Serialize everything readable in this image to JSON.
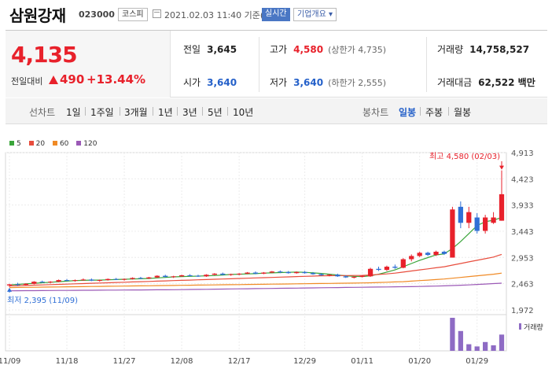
{
  "header": {
    "name": "삼원강재",
    "code": "023000",
    "market": "코스피",
    "timestamp": "2021.02.03 11:40 기준(장중)",
    "realtime_label": "실시간",
    "corp_info_label": "기업개요 ▾"
  },
  "quote": {
    "price": "4,135",
    "change_label": "전일대비",
    "change": "490",
    "change_pct": "+13.44%",
    "prev_close_label": "전일",
    "prev_close": "3,645",
    "high_label": "고가",
    "high": "4,580",
    "upper_limit": "(상한가 4,735)",
    "volume_label": "거래량",
    "volume": "14,758,527",
    "open_label": "시가",
    "open": "3,640",
    "low_label": "저가",
    "low": "3,640",
    "lower_limit": "(하한가 2,555)",
    "value_label": "거래대금",
    "value": "62,522 백만"
  },
  "periods": {
    "label": "선차트",
    "items": [
      "1일",
      "1주일",
      "3개월",
      "1년",
      "3년",
      "5년",
      "10년"
    ],
    "candle_label": "봉차트",
    "candle_items": [
      "일봉",
      "주봉",
      "월봉"
    ],
    "candle_selected": "일봉"
  },
  "legend": [
    {
      "label": "5",
      "color": "#3aa53a"
    },
    {
      "label": "20",
      "color": "#e84d3d"
    },
    {
      "label": "60",
      "color": "#f08a25"
    },
    {
      "label": "120",
      "color": "#9b59b6"
    }
  ],
  "chart_data": {
    "type": "candlestick",
    "y_ticks": [
      "4,913",
      "4,423",
      "3,933",
      "3,443",
      "2,953",
      "2,463",
      "1,972"
    ],
    "y_tick_values": [
      4913,
      4423,
      3933,
      3443,
      2953,
      2463,
      1972
    ],
    "ylim": [
      1972,
      4913
    ],
    "x_tick_labels": [
      "11/09",
      "11/18",
      "11/27",
      "12/08",
      "12/17",
      "12/29",
      "01/11",
      "01/20",
      "01/29"
    ],
    "x_tick_index": [
      0,
      7,
      14,
      21,
      28,
      36,
      43,
      50,
      57
    ],
    "max_annotation": "최고 4,580 (02/03)",
    "min_annotation": "최저 2,395 (11/09)",
    "volume_label": "거래량",
    "candles": [
      [
        2430,
        2460,
        2400,
        2450
      ],
      [
        2450,
        2480,
        2420,
        2440
      ],
      [
        2440,
        2470,
        2430,
        2460
      ],
      [
        2460,
        2510,
        2450,
        2500
      ],
      [
        2500,
        2520,
        2480,
        2490
      ],
      [
        2490,
        2510,
        2470,
        2500
      ],
      [
        2500,
        2540,
        2490,
        2530
      ],
      [
        2530,
        2550,
        2510,
        2520
      ],
      [
        2520,
        2540,
        2500,
        2530
      ],
      [
        2530,
        2560,
        2520,
        2540
      ],
      [
        2540,
        2560,
        2510,
        2520
      ],
      [
        2520,
        2540,
        2500,
        2530
      ],
      [
        2530,
        2560,
        2520,
        2550
      ],
      [
        2550,
        2570,
        2530,
        2540
      ],
      [
        2540,
        2560,
        2520,
        2550
      ],
      [
        2550,
        2580,
        2540,
        2570
      ],
      [
        2570,
        2590,
        2550,
        2560
      ],
      [
        2560,
        2590,
        2550,
        2580
      ],
      [
        2580,
        2620,
        2570,
        2610
      ],
      [
        2610,
        2630,
        2580,
        2590
      ],
      [
        2590,
        2610,
        2570,
        2600
      ],
      [
        2600,
        2630,
        2590,
        2620
      ],
      [
        2620,
        2640,
        2600,
        2610
      ],
      [
        2610,
        2630,
        2590,
        2600
      ],
      [
        2600,
        2640,
        2590,
        2630
      ],
      [
        2630,
        2660,
        2620,
        2650
      ],
      [
        2650,
        2670,
        2620,
        2630
      ],
      [
        2630,
        2650,
        2610,
        2640
      ],
      [
        2640,
        2660,
        2620,
        2650
      ],
      [
        2650,
        2680,
        2640,
        2670
      ],
      [
        2670,
        2690,
        2640,
        2650
      ],
      [
        2650,
        2680,
        2640,
        2670
      ],
      [
        2670,
        2700,
        2660,
        2690
      ],
      [
        2690,
        2710,
        2660,
        2680
      ],
      [
        2680,
        2700,
        2650,
        2660
      ],
      [
        2660,
        2690,
        2650,
        2680
      ],
      [
        2680,
        2700,
        2650,
        2660
      ],
      [
        2660,
        2680,
        2630,
        2640
      ],
      [
        2640,
        2660,
        2610,
        2620
      ],
      [
        2620,
        2640,
        2600,
        2630
      ],
      [
        2630,
        2650,
        2590,
        2600
      ],
      [
        2600,
        2620,
        2570,
        2580
      ],
      [
        2580,
        2600,
        2560,
        2590
      ],
      [
        2590,
        2620,
        2580,
        2610
      ],
      [
        2600,
        2760,
        2590,
        2740
      ],
      [
        2740,
        2780,
        2700,
        2720
      ],
      [
        2720,
        2800,
        2700,
        2780
      ],
      [
        2780,
        2820,
        2740,
        2760
      ],
      [
        2760,
        2940,
        2750,
        2920
      ],
      [
        2920,
        3010,
        2880,
        2980
      ],
      [
        2980,
        3060,
        2960,
        3040
      ],
      [
        3040,
        3060,
        2980,
        3000
      ],
      [
        3000,
        3080,
        2980,
        3060
      ],
      [
        3060,
        3080,
        3000,
        3020
      ],
      [
        2950,
        3900,
        2950,
        3850
      ],
      [
        3900,
        4000,
        3500,
        3600
      ],
      [
        3600,
        3900,
        3500,
        3800
      ],
      [
        3700,
        3780,
        3400,
        3450
      ],
      [
        3450,
        3750,
        3400,
        3700
      ],
      [
        3600,
        3800,
        3580,
        3700
      ],
      [
        3640,
        4580,
        3640,
        4135
      ]
    ],
    "volumes": [
      0,
      0,
      0,
      0,
      0,
      0,
      0,
      0,
      0,
      0,
      0,
      0,
      0,
      0,
      0,
      0,
      0,
      0,
      0,
      0,
      0,
      0,
      0,
      0,
      0,
      0,
      0,
      0,
      0,
      0,
      0,
      0,
      0,
      0,
      0,
      0,
      0,
      0,
      0,
      0,
      0,
      0,
      0,
      0,
      0,
      0,
      0,
      0,
      0,
      0,
      0,
      0,
      0,
      0,
      30000000,
      18000000,
      6000000,
      4000000,
      8000000,
      5000000,
      14758527
    ],
    "ma_series": [
      {
        "name": "5",
        "color": "#3aa53a",
        "values": [
          2440,
          2450,
          2460,
          2470,
          2480,
          2490,
          2500,
          2510,
          2520,
          2525,
          2530,
          2530,
          2535,
          2540,
          2545,
          2550,
          2555,
          2560,
          2570,
          2580,
          2590,
          2595,
          2600,
          2605,
          2610,
          2615,
          2625,
          2635,
          2640,
          2645,
          2650,
          2660,
          2665,
          2670,
          2675,
          2680,
          2675,
          2665,
          2655,
          2640,
          2625,
          2610,
          2600,
          2595,
          2610,
          2640,
          2680,
          2720,
          2780,
          2840,
          2900,
          2950,
          3000,
          3020,
          3120,
          3250,
          3400,
          3550,
          3620,
          3650,
          3700
        ]
      },
      {
        "name": "20",
        "color": "#e84d3d",
        "values": [
          2420,
          2425,
          2430,
          2435,
          2440,
          2445,
          2450,
          2455,
          2460,
          2465,
          2470,
          2475,
          2480,
          2485,
          2490,
          2495,
          2500,
          2505,
          2510,
          2515,
          2520,
          2525,
          2530,
          2535,
          2540,
          2545,
          2550,
          2555,
          2560,
          2565,
          2570,
          2575,
          2580,
          2585,
          2590,
          2595,
          2600,
          2605,
          2610,
          2612,
          2614,
          2615,
          2616,
          2618,
          2625,
          2635,
          2645,
          2660,
          2680,
          2700,
          2720,
          2740,
          2760,
          2780,
          2810,
          2840,
          2870,
          2900,
          2930,
          2960,
          3010
        ]
      },
      {
        "name": "60",
        "color": "#f08a25",
        "values": [
          2390,
          2392,
          2394,
          2396,
          2398,
          2400,
          2402,
          2404,
          2406,
          2408,
          2410,
          2412,
          2414,
          2416,
          2418,
          2420,
          2422,
          2424,
          2426,
          2428,
          2430,
          2432,
          2434,
          2436,
          2438,
          2440,
          2442,
          2444,
          2446,
          2448,
          2450,
          2452,
          2454,
          2456,
          2458,
          2460,
          2462,
          2464,
          2466,
          2468,
          2470,
          2472,
          2474,
          2476,
          2480,
          2485,
          2490,
          2495,
          2500,
          2510,
          2520,
          2530,
          2540,
          2550,
          2565,
          2580,
          2595,
          2610,
          2625,
          2640,
          2660
        ]
      },
      {
        "name": "120",
        "color": "#9b59b6",
        "values": [
          2330,
          2331,
          2332,
          2333,
          2334,
          2335,
          2336,
          2337,
          2338,
          2339,
          2340,
          2341,
          2342,
          2343,
          2344,
          2345,
          2346,
          2347,
          2348,
          2349,
          2350,
          2352,
          2354,
          2356,
          2358,
          2360,
          2362,
          2364,
          2366,
          2368,
          2370,
          2372,
          2374,
          2376,
          2378,
          2380,
          2382,
          2384,
          2386,
          2388,
          2390,
          2392,
          2394,
          2396,
          2398,
          2400,
          2402,
          2404,
          2406,
          2408,
          2410,
          2414,
          2418,
          2422,
          2428,
          2434,
          2440,
          2448,
          2456,
          2464,
          2472
        ]
      }
    ]
  }
}
